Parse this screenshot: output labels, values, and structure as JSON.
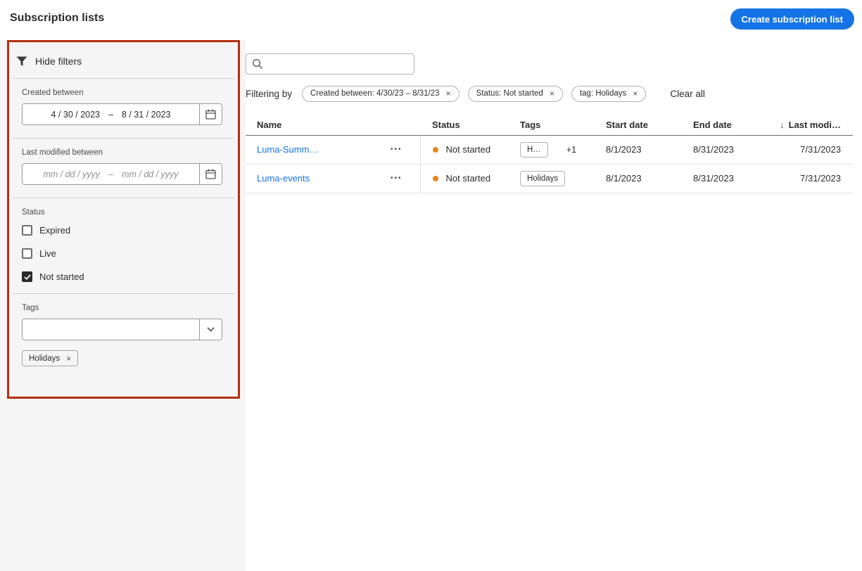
{
  "colors": {
    "accent_blue": "#1473e6",
    "link_blue": "#1473e6",
    "status_orange": "#e68619",
    "highlight_red": "#b1300e"
  },
  "icons": {
    "filter": "funnel",
    "search": "magnifier",
    "calendar": "calendar",
    "chevron_down": "chevron-down",
    "close": "×",
    "more_actions": "•••",
    "sort_desc": "↓"
  },
  "header": {
    "title": "Subscription lists",
    "create_button_label": "Create subscription list"
  },
  "filters": {
    "hide_filters_label": "Hide filters",
    "created_between": {
      "label": "Created between",
      "start_value": "4 / 30 / 2023",
      "separator": "–",
      "end_value": "8 / 31 / 2023"
    },
    "last_modified_between": {
      "label": "Last modified between",
      "start_placeholder": "mm / dd / yyyy",
      "separator": "–",
      "end_placeholder": "mm / dd / yyyy"
    },
    "status": {
      "label": "Status",
      "options": [
        {
          "label": "Expired",
          "checked": false
        },
        {
          "label": "Live",
          "checked": false
        },
        {
          "label": "Not started",
          "checked": true
        }
      ]
    },
    "tags": {
      "label": "Tags",
      "input_value": "",
      "selected": [
        {
          "label": "Holidays"
        }
      ]
    }
  },
  "toolbar": {
    "search": {
      "value": "",
      "placeholder": ""
    },
    "filtering_by_label": "Filtering by",
    "pills": [
      {
        "label": "Created between: 4/30/23 – 8/31/23"
      },
      {
        "label": "Status: Not started"
      },
      {
        "label": "tag: Holidays"
      }
    ],
    "clear_all_label": "Clear all"
  },
  "table": {
    "columns": {
      "name": "Name",
      "status": "Status",
      "tags": "Tags",
      "start_date": "Start date",
      "end_date": "End date",
      "last_modified": "Last modi…"
    },
    "sorted_by": "last_modified",
    "sort_direction": "descending",
    "rows": [
      {
        "name": "Luma-Summ…",
        "status": "Not started",
        "tag_chip": "H…",
        "tags_overflow": "+1",
        "start_date": "8/1/2023",
        "end_date": "8/31/2023",
        "last_modified": "7/31/2023"
      },
      {
        "name": "Luma-events",
        "status": "Not started",
        "tag_chip": "Holidays",
        "start_date": "8/1/2023",
        "end_date": "8/31/2023",
        "last_modified": "7/31/2023"
      }
    ]
  }
}
